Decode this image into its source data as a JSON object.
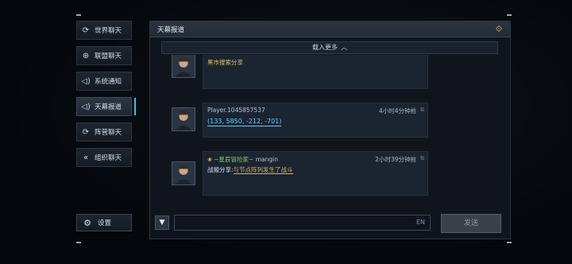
{
  "sidebar": {
    "items": [
      {
        "label": "世界聊天",
        "icon": "world-chat-icon"
      },
      {
        "label": "联盟聊天",
        "icon": "globe-icon"
      },
      {
        "label": "系统通知",
        "icon": "speaker-icon"
      },
      {
        "label": "天幕报道",
        "icon": "speaker-icon"
      },
      {
        "label": "阵营聊天",
        "icon": "faction-icon"
      },
      {
        "label": "组织聊天",
        "icon": "organization-icon"
      }
    ],
    "active_index": 3,
    "settings_label": "设置"
  },
  "panel": {
    "title": "天幕报道",
    "load_more": "载入更多"
  },
  "messages": [
    {
      "text": "黑市搜索分享"
    },
    {
      "name": "Player.1045857537",
      "time": "4小时4分钟前",
      "coords": "(133, 5850, -212, -701)"
    },
    {
      "guild": "~星辰冒险家~",
      "name": "mangin",
      "time": "2小时39分钟前",
      "report_label": "战报分享:",
      "report_link": "与节点阵列发生了战斗"
    }
  ],
  "input": {
    "language": "EN",
    "send_label": "发送"
  },
  "colors": {
    "accent": "#3bc0e3",
    "coords": "#5bd0ff",
    "link": "#e3b24c",
    "guild": "#7fd25a"
  }
}
